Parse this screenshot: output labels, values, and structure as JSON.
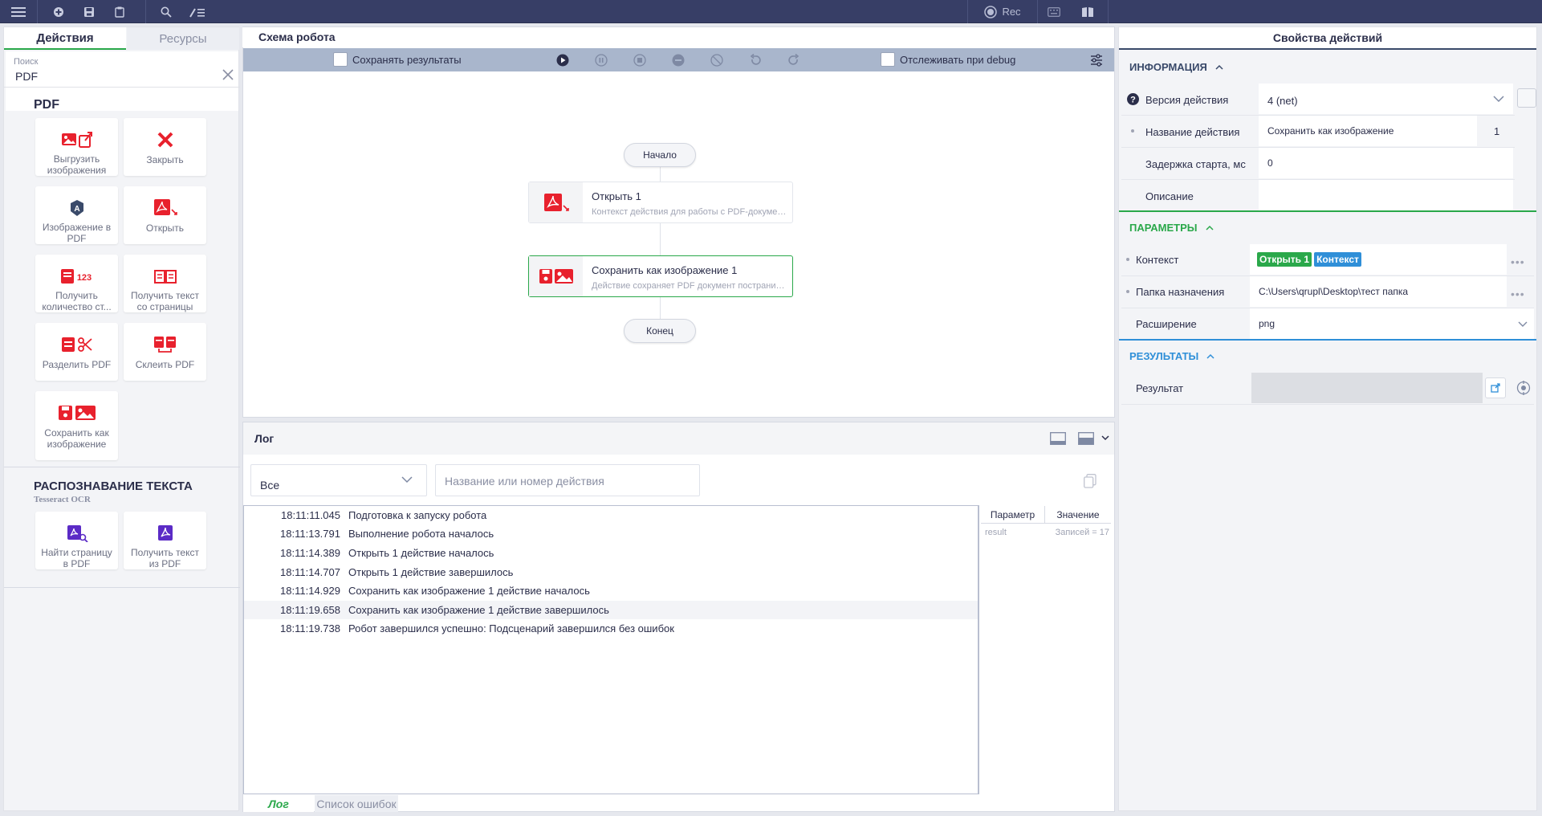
{
  "toolbar": {
    "rec_label": "Rec"
  },
  "left": {
    "tabs": [
      "Действия",
      "Ресурсы"
    ],
    "search": {
      "label": "Поиск",
      "value": "PDF"
    },
    "sections": [
      {
        "title": "PDF",
        "subtitle": "",
        "tiles": [
          "Выгрузить изображения",
          "Закрыть",
          "Изображение в PDF",
          "Открыть",
          "Получить количество ст...",
          "Получить текст со страницы",
          "Разделить PDF",
          "Склеить PDF",
          "Сохранить как изображение"
        ]
      },
      {
        "title": "РАСПОЗНАВАНИЕ ТЕКСТА",
        "subtitle": "Tesseract OCR",
        "tiles": [
          "Найти страницу в PDF",
          "Получить текст из PDF"
        ]
      }
    ]
  },
  "schema": {
    "tab": "Схема робота",
    "save_results": "Сохранять результаты",
    "track_debug": "Отслеживать при debug",
    "start": "Начало",
    "end": "Конец",
    "nodes": [
      {
        "title": "Открыть  1",
        "desc": "Контекст действия для работы с PDF-документом"
      },
      {
        "title": "Сохранить как изображение  1",
        "desc": "Действие сохраняет PDF документ постранично в изображения"
      }
    ]
  },
  "log": {
    "title": "Лог",
    "filter": "Все",
    "search_placeholder": "Название или номер действия",
    "rows": [
      {
        "time": "18:11:11.045",
        "msg": "Подготовка к запуску робота"
      },
      {
        "time": "18:11:13.791",
        "msg": "Выполнение робота началось"
      },
      {
        "time": "18:11:14.389",
        "msg": "Открыть 1 действие началось"
      },
      {
        "time": "18:11:14.707",
        "msg": "Открыть 1 действие завершилось"
      },
      {
        "time": "18:11:14.929",
        "msg": "Сохранить как изображение 1 действие началось"
      },
      {
        "time": "18:11:19.658",
        "msg": "Сохранить как изображение 1 действие завершилось"
      },
      {
        "time": "18:11:19.738",
        "msg": "Робот завершился успешно: Подсценарий завершился без ошибок"
      }
    ],
    "selected_row": 5,
    "param_table": {
      "headers": [
        "Параметр",
        "Значение"
      ],
      "rows": [
        {
          "param": "result",
          "value": "Записей = 17"
        }
      ]
    },
    "footer_tabs": [
      "Лог",
      "Список ошибок"
    ]
  },
  "props": {
    "title": "Свойства действий",
    "info": {
      "header": "ИНФОРМАЦИЯ",
      "version_label": "Версия действия",
      "version_value": "4 (net)",
      "name_label": "Название действия",
      "name_value": "Сохранить как изображение",
      "name_index": "1",
      "delay_label": "Задержка старта, мс",
      "delay_value": "0",
      "desc_label": "Описание",
      "desc_value": ""
    },
    "params": {
      "header": "ПАРАМЕТРЫ",
      "context_label": "Контекст",
      "context_tag1": "Открыть 1",
      "context_tag2": "Контекст",
      "folder_label": "Папка назначения",
      "folder_value": "C:\\Users\\qrupl\\Desktop\\тест папка",
      "ext_label": "Расширение",
      "ext_value": "png"
    },
    "results": {
      "header": "РЕЗУЛЬТАТЫ",
      "result_label": "Результат"
    }
  },
  "colors": {
    "topbar": "#373e66",
    "accent_green": "#2aa84a",
    "accent_blue": "#2f8fd8",
    "pdf_red": "#e8212d",
    "ocr_purple": "#5b2bc6",
    "section_dark": "#3a4a6a"
  }
}
